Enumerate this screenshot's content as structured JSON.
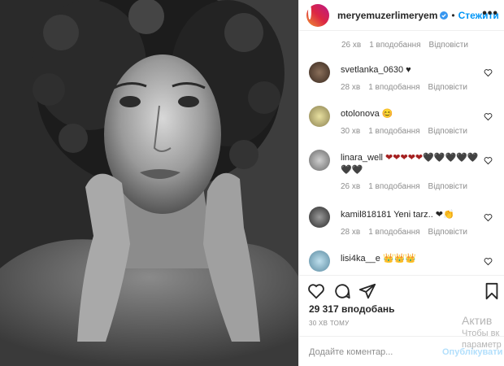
{
  "header": {
    "username": "meryemuzerlimeryem",
    "dot": "•",
    "follow_label": "Стежити",
    "more_label": "•••"
  },
  "first_meta": {
    "time": "26 хв",
    "likes": "1 вподобання",
    "reply": "Відповісти"
  },
  "comments": [
    {
      "user": "svetlanka_0630",
      "text": " ♥",
      "time": "28 хв",
      "likes": "1 вподобання",
      "reply": "Відповісти"
    },
    {
      "user": "otolonova",
      "text": " 😊",
      "time": "30 хв",
      "likes": "1 вподобання",
      "reply": "Відповісти"
    },
    {
      "user": "linara_well",
      "text": " ❤❤❤❤❤🖤🖤🖤🖤🖤🖤🖤",
      "time": "26 хв",
      "likes": "1 вподобання",
      "reply": "Відповісти"
    },
    {
      "user": "kamil818181",
      "text": " Yeni tarz.. ❤👏",
      "time": "28 хв",
      "likes": "1 вподобання",
      "reply": "Відповісти"
    },
    {
      "user": "lisi4ka__e",
      "text": " 👑👑👑",
      "time": "",
      "likes": "",
      "reply": ""
    }
  ],
  "likes_count": "29 317 вподобань",
  "post_time": "30 ХВ ТОМУ",
  "add_comment": {
    "placeholder": "Додайте коментар...",
    "publish_label": "Опублікувати"
  },
  "watermark": {
    "line1": "Актив",
    "line2": "Чтобы вк",
    "line3": "параметр"
  },
  "colors": {
    "follow": "#0095f6",
    "muted": "#8e8e8e",
    "text": "#262626"
  },
  "icons": [
    "verified-badge-icon",
    "more-options-icon",
    "heart-icon",
    "comment-icon",
    "share-icon",
    "bookmark-icon"
  ]
}
